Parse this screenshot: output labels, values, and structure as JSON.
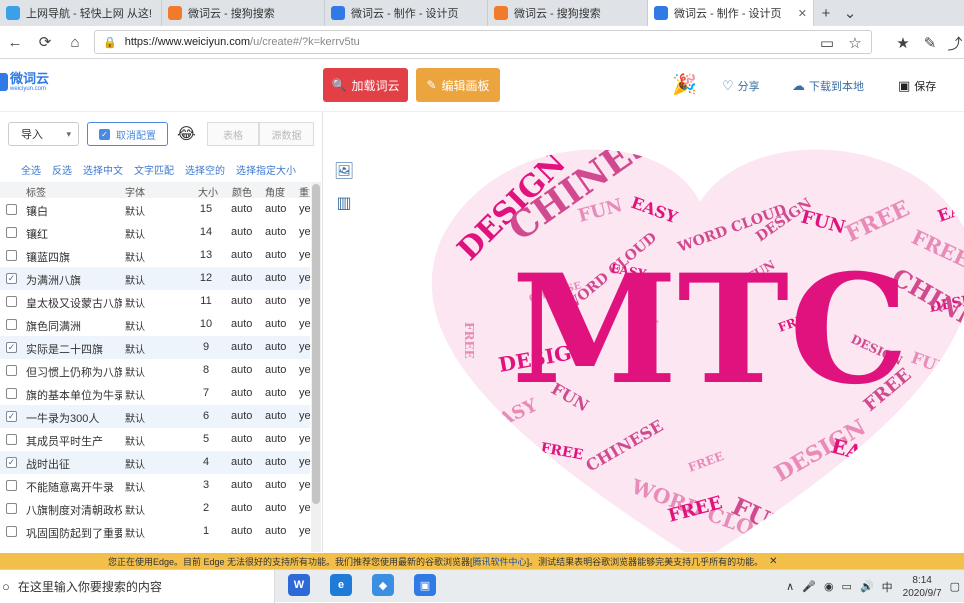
{
  "tabs": [
    {
      "label": "上网导航 - 轻快上网 从这!",
      "icon": "globe-icon",
      "color": "#3aa1e8"
    },
    {
      "label": "微词云 - 搜狗搜索",
      "icon": "sogou-icon",
      "color": "#f07b2c"
    },
    {
      "label": "微词云 - 制作 - 设计页",
      "icon": "weiciyun-icon",
      "color": "#2f7ae5"
    },
    {
      "label": "微词云 - 搜狗搜索",
      "icon": "sogou-icon",
      "color": "#f07b2c"
    },
    {
      "label": "微词云 - 制作 - 设计页",
      "icon": "weiciyun-icon",
      "color": "#2f7ae5"
    }
  ],
  "url": {
    "host": "https://www.weiciyun.com",
    "path": "/u/create#/?k=kerrv5tu"
  },
  "logo": {
    "name": "微词云",
    "sub": "weiciyun.com"
  },
  "header": {
    "load_label": "加载词云",
    "edit_label": "编辑画板",
    "share_label": "分享",
    "download_label": "下载到本地",
    "save_label": "保存"
  },
  "toolbar": {
    "import_label": "导入",
    "cancel_label": "取消配置",
    "table_label": "表格",
    "source_label": "源数据"
  },
  "filters": [
    "全选",
    "反选",
    "选择中文",
    "文字匹配",
    "选择空的",
    "选择指定大小"
  ],
  "columns": {
    "label": "标签",
    "font": "字体",
    "size": "大小",
    "color": "颜色",
    "angle": "角度",
    "repeat": "重复"
  },
  "rows": [
    {
      "label": "镶白",
      "font": "默认",
      "size": "15",
      "color": "auto",
      "angle": "auto",
      "repeat": "yes",
      "checked": false
    },
    {
      "label": "镶红",
      "font": "默认",
      "size": "14",
      "color": "auto",
      "angle": "auto",
      "repeat": "yes",
      "checked": false
    },
    {
      "label": "镶蓝四旗",
      "font": "默认",
      "size": "13",
      "color": "auto",
      "angle": "auto",
      "repeat": "yes",
      "checked": false
    },
    {
      "label": "为满洲八旗",
      "font": "默认",
      "size": "12",
      "color": "auto",
      "angle": "auto",
      "repeat": "yes",
      "checked": true
    },
    {
      "label": "皇太极又设蒙古八旗",
      "font": "默认",
      "size": "11",
      "color": "auto",
      "angle": "auto",
      "repeat": "yes",
      "checked": false
    },
    {
      "label": "旗色同满洲",
      "font": "默认",
      "size": "10",
      "color": "auto",
      "angle": "auto",
      "repeat": "yes",
      "checked": false
    },
    {
      "label": "实际是二十四旗",
      "font": "默认",
      "size": "9",
      "color": "auto",
      "angle": "auto",
      "repeat": "yes",
      "checked": true
    },
    {
      "label": "但习惯上仍称为八旗",
      "font": "默认",
      "size": "8",
      "color": "auto",
      "angle": "auto",
      "repeat": "yes",
      "checked": false
    },
    {
      "label": "旗的基本单位为牛录",
      "font": "默认",
      "size": "7",
      "color": "auto",
      "angle": "auto",
      "repeat": "yes",
      "checked": false
    },
    {
      "label": "一牛录为300人",
      "font": "默认",
      "size": "6",
      "color": "auto",
      "angle": "auto",
      "repeat": "yes",
      "checked": true
    },
    {
      "label": "其成员平时生产",
      "font": "默认",
      "size": "5",
      "color": "auto",
      "angle": "auto",
      "repeat": "yes",
      "checked": false
    },
    {
      "label": "战时出征",
      "font": "默认",
      "size": "4",
      "color": "auto",
      "angle": "auto",
      "repeat": "yes",
      "checked": true
    },
    {
      "label": "不能随意离开牛录",
      "font": "默认",
      "size": "3",
      "color": "auto",
      "angle": "auto",
      "repeat": "yes",
      "checked": false
    },
    {
      "label": "八旗制度对清朝政权",
      "font": "默认",
      "size": "2",
      "color": "auto",
      "angle": "auto",
      "repeat": "yes",
      "checked": false
    },
    {
      "label": "巩固国防起到了重要",
      "font": "默认",
      "size": "1",
      "color": "auto",
      "angle": "auto",
      "repeat": "yes",
      "checked": false
    }
  ],
  "cloud": {
    "center_text": "MTC",
    "accent_color": "#e0137e",
    "words": [
      "DESIGN",
      "CHINESE",
      "FUN",
      "EASY",
      "WORD CLOUD",
      "FREE",
      "DESIGN",
      "FUN",
      "EASY",
      "FREE",
      "CHINESE",
      "WORD CLOUD",
      "FREE",
      "FUN",
      "DESIGN",
      "EASY",
      "FREE",
      "FUN",
      "DESIGN",
      "CHINESE",
      "FREE",
      "FUN",
      "DESIGN",
      "FREE",
      "EASY",
      "WORD CLOUD",
      "FUN",
      "FREE",
      "DESIGN",
      "CHINESE",
      "EASY",
      "FUN",
      "FREE",
      "DESIGN",
      "FREE",
      "FUN"
    ]
  },
  "notify": {
    "pre": "您正在使用Edge。目前 Edge 无法很好的支持所有功能。我们推荐您使用最新的谷歌浏览器[",
    "link": "腾讯软件中心",
    "post": "]。测试结果表明谷歌浏览器能够完美支持几乎所有的功能。"
  },
  "taskbar": {
    "search_placeholder": "在这里输入你要搜索的内容",
    "ime": "中",
    "time": "8:14",
    "date": "2020/9/7"
  }
}
